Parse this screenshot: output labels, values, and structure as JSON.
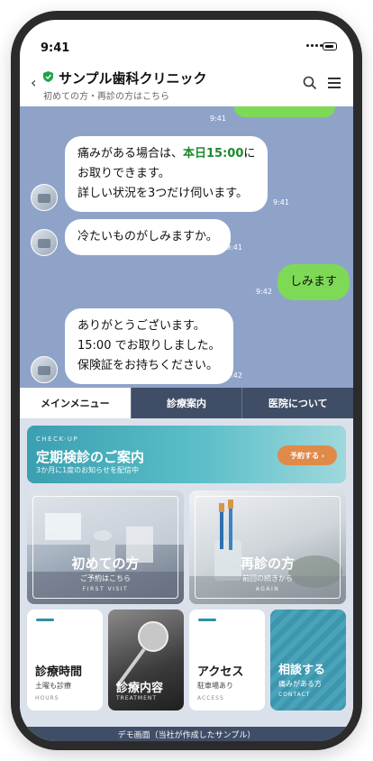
{
  "status_bar": {
    "time": "9:41"
  },
  "header": {
    "title": "サンプル歯科クリニック",
    "subtitle": "初めての方・再診の方はこちら"
  },
  "chat": {
    "top_timestamp": "9:41",
    "msg1": {
      "line1_prefix": "痛みがある場合は、",
      "line1_highlight": "本日15:00",
      "line1_suffix": "に",
      "line2": "お取りできます。",
      "line3": "詳しい状況を3つだけ伺います。",
      "time": "9:41"
    },
    "msg2": {
      "text": "冷たいものがしみますか。",
      "time": "9:41"
    },
    "msg3": {
      "text": "しみます",
      "time": "9:42"
    },
    "msg4": {
      "line1": "ありがとうございます。",
      "line2": "15:00 でお取りしました。",
      "line3": "保険証をお持ちください。",
      "time": "9:42"
    }
  },
  "tabs": [
    {
      "label": "メインメニュー"
    },
    {
      "label": "診療案内"
    },
    {
      "label": "医院について"
    }
  ],
  "banner": {
    "eyebrow": "CHECK-UP",
    "title": "定期検診のご案内",
    "subtitle": "3か月に1度のお知らせを配信中",
    "button": "予約する ›"
  },
  "cards": {
    "first_visit": {
      "title": "初めての方",
      "subtitle": "ご予約はこちら",
      "en": "FIRST VISIT"
    },
    "again": {
      "title": "再診の方",
      "subtitle": "前回の続きから",
      "en": "AGAIN"
    }
  },
  "small_cards": {
    "hours": {
      "title": "診療時間",
      "subtitle": "土曜も診療",
      "en": "HOURS"
    },
    "treatment": {
      "title": "診療内容",
      "en": "TREATMENT"
    },
    "access": {
      "title": "アクセス",
      "subtitle": "駐車場あり",
      "en": "ACCESS"
    },
    "contact": {
      "title": "相談する",
      "subtitle": "痛みがある方",
      "en": "CONTACT"
    }
  },
  "footer": {
    "text": "デモ画面（当社が作成したサンプル）"
  },
  "colors": {
    "chat_bg": "#8fa3c9",
    "my_bubble": "#7ed957",
    "highlight": "#1c8a2c",
    "nav_dark": "#3f4d66",
    "banner_button": "#e08a4a",
    "accent_teal": "#2f8ea6"
  },
  "icons": [
    "back-chevron-icon",
    "verified-shield-icon",
    "search-icon",
    "hamburger-menu-icon"
  ]
}
